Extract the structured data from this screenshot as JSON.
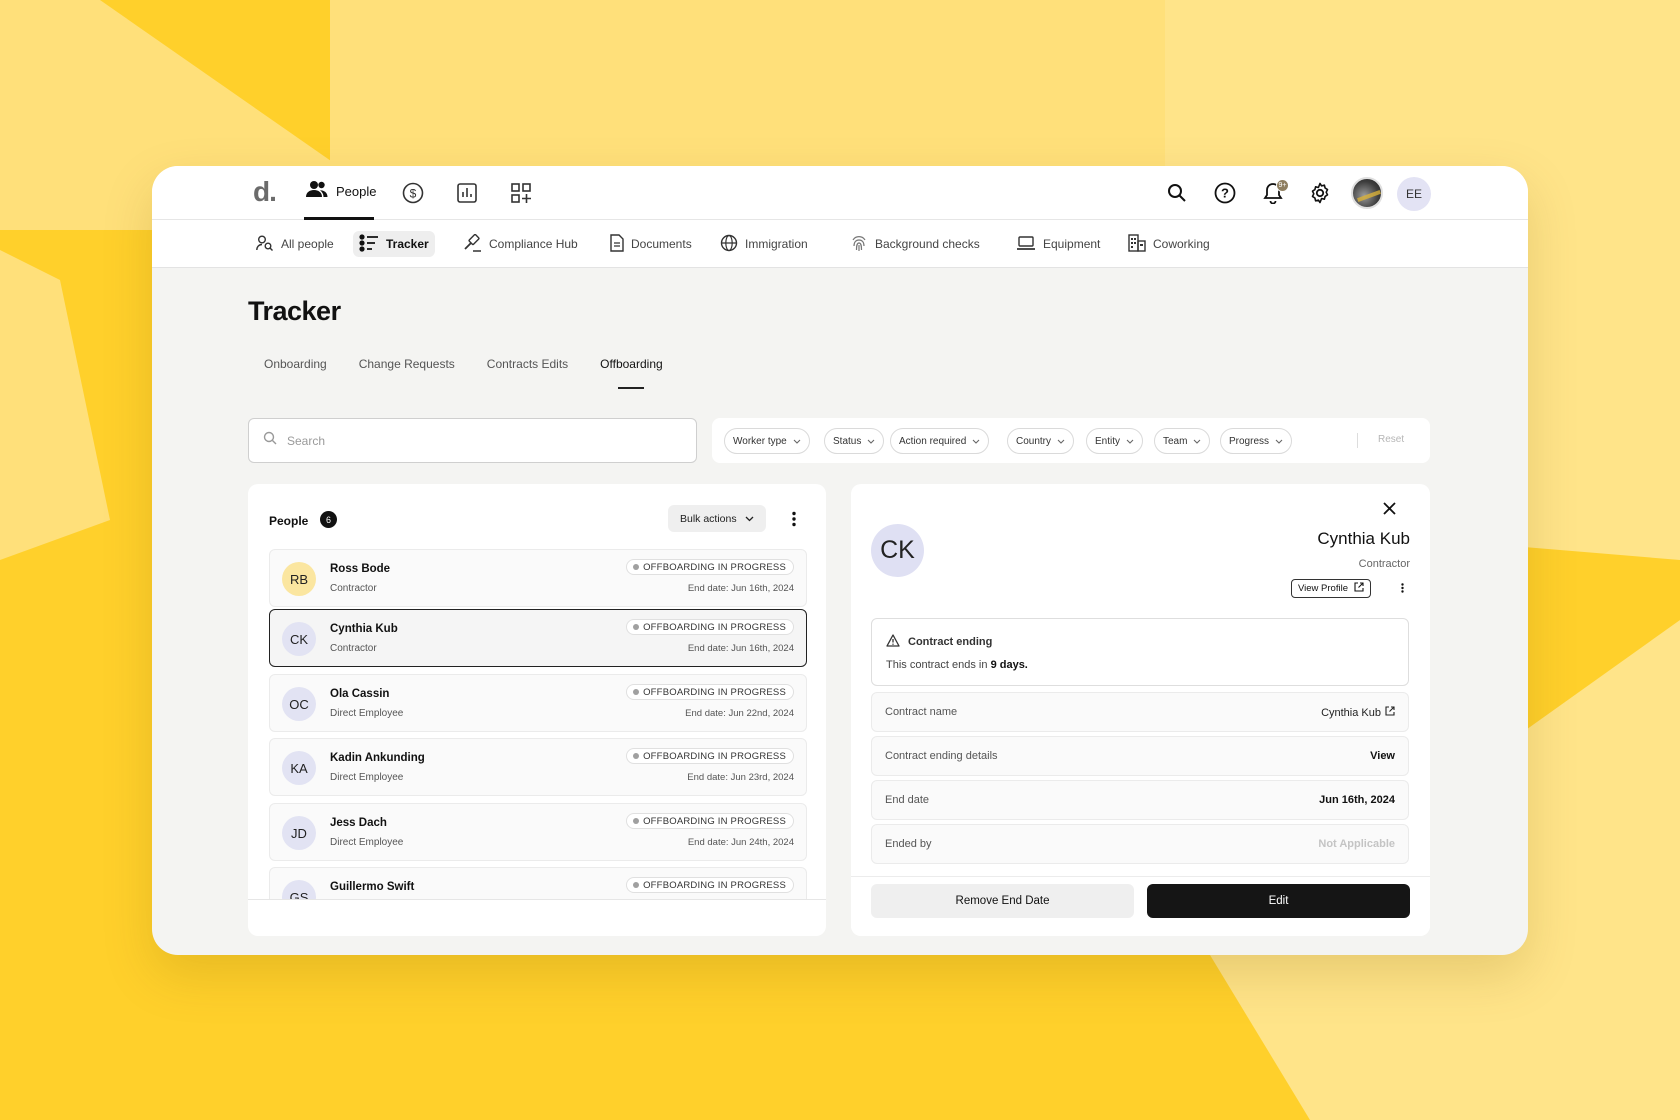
{
  "brand": {
    "logo": "d.",
    "background_color": "#FFD02B",
    "accent": "#151515"
  },
  "topnav": {
    "people_label": "People",
    "icons": [
      "users-icon",
      "dollar-icon",
      "chart-icon",
      "apps-icon"
    ],
    "notification_badge": "9+",
    "user_initials": "EE"
  },
  "subnav": {
    "items": [
      {
        "label": "All people",
        "icon": "person-search-icon"
      },
      {
        "label": "Tracker",
        "icon": "tracker-icon",
        "active": true
      },
      {
        "label": "Compliance Hub",
        "icon": "gavel-icon"
      },
      {
        "label": "Documents",
        "icon": "document-icon"
      },
      {
        "label": "Immigration",
        "icon": "globe-icon"
      },
      {
        "label": "Background checks",
        "icon": "fingerprint-icon"
      },
      {
        "label": "Equipment",
        "icon": "laptop-icon"
      },
      {
        "label": "Coworking",
        "icon": "building-icon"
      }
    ]
  },
  "page": {
    "title": "Tracker",
    "tabs": [
      "Onboarding",
      "Change Requests",
      "Contracts Edits",
      "Offboarding"
    ],
    "active_tab": "Offboarding"
  },
  "search": {
    "placeholder": "Search",
    "value": ""
  },
  "filters": {
    "chips": [
      "Worker type",
      "Status",
      "Action required",
      "Country",
      "Entity",
      "Team",
      "Progress"
    ],
    "reset_label": "Reset"
  },
  "people_panel": {
    "title": "People",
    "count": "6",
    "bulk_actions_label": "Bulk actions",
    "rows": [
      {
        "initials": "RB",
        "name": "Ross Bode",
        "type": "Contractor",
        "status": "OFFBOARDING IN PROGRESS",
        "end_date": "End date: Jun 16th, 2024"
      },
      {
        "initials": "CK",
        "name": "Cynthia Kub",
        "type": "Contractor",
        "status": "OFFBOARDING IN PROGRESS",
        "end_date": "End date: Jun 16th, 2024",
        "selected": true
      },
      {
        "initials": "OC",
        "name": "Ola Cassin",
        "type": "Direct Employee",
        "status": "OFFBOARDING IN PROGRESS",
        "end_date": "End date: Jun 22nd, 2024"
      },
      {
        "initials": "KA",
        "name": "Kadin Ankunding",
        "type": "Direct Employee",
        "status": "OFFBOARDING IN PROGRESS",
        "end_date": "End date: Jun 23rd, 2024"
      },
      {
        "initials": "JD",
        "name": "Jess Dach",
        "type": "Direct Employee",
        "status": "OFFBOARDING IN PROGRESS",
        "end_date": "End date: Jun 24th, 2024"
      },
      {
        "initials": "GS",
        "name": "Guillermo Swift",
        "type": "",
        "status": "OFFBOARDING IN PROGRESS",
        "end_date": ""
      }
    ]
  },
  "detail": {
    "initials": "CK",
    "name": "Cynthia Kub",
    "type": "Contractor",
    "view_profile_label": "View Profile",
    "alert_title": "Contract ending",
    "alert_text_prefix": "This contract ends in ",
    "alert_days": "9 days.",
    "fields": [
      {
        "label": "Contract name",
        "value": "Cynthia Kub"
      },
      {
        "label": "Contract ending details",
        "value": "View"
      },
      {
        "label": "End date",
        "value": "Jun 16th, 2024"
      },
      {
        "label": "Ended by",
        "value": "Not Applicable"
      }
    ],
    "remove_label": "Remove End Date",
    "edit_label": "Edit"
  }
}
